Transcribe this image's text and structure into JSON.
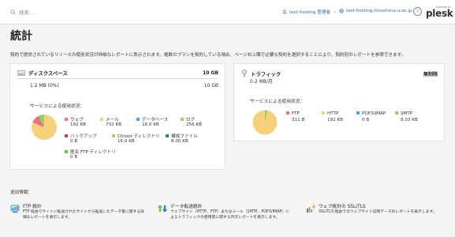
{
  "topbar": {
    "search_placeholder": "検索...",
    "user_label": "test-hosting 管理者",
    "domain_label": "test-hosting.hiroshima-u.ac.jp",
    "help_label": "?",
    "logo_small": "POWERED BY",
    "logo_text": "plesk"
  },
  "page": {
    "title": "統計",
    "description": "契約で提供されているリソースの使用状況が詳細なレポートに表示されます。複数のプランを契約している場合、ページ右上隅で必要な契約を選択することにより、契約別のレポートを参照できます。"
  },
  "disk": {
    "title": "ディスクスペース",
    "limit": "10 GB",
    "used": "1.2 MB (0%)",
    "total": "10 GB",
    "services_label": "サービスによる使用状況：",
    "items": [
      {
        "label": "ウェブ",
        "value": "192 KB",
        "color": "#e8737f"
      },
      {
        "label": "メール",
        "value": "732 KB",
        "color": "#f7d07a"
      },
      {
        "label": "データベース",
        "value": "16.0 KB",
        "color": "#4aa7e0"
      },
      {
        "label": "ログ",
        "value": "256 KB",
        "color": "#8bd36a"
      },
      {
        "label": "バックアップ",
        "value": "0 B",
        "color": "#b04848"
      },
      {
        "label": "Chroot ディレクトリ",
        "value": "16.0 KB",
        "color": "#d4b07a"
      },
      {
        "label": "構成ファイル",
        "value": "8.00 KB",
        "color": "#2f7bb5"
      },
      {
        "label": "匿名 FTP ディレクトリ",
        "value": "0 B",
        "color": "#6cc04a"
      }
    ]
  },
  "traffic": {
    "title": "トラフィック",
    "limit": "無制限",
    "used": "0.2 MB/月",
    "services_label": "サービスによる使用状況：",
    "items": [
      {
        "label": "FTP",
        "value": "311 B",
        "color": "#e8737f"
      },
      {
        "label": "HTTP",
        "value": "192 KB",
        "color": "#f7d07a"
      },
      {
        "label": "POP3/IMAP",
        "value": "0 B",
        "color": "#4aa7e0"
      },
      {
        "label": "SMTP",
        "value": "8.03 KB",
        "color": "#8bd36a"
      }
    ]
  },
  "additional": {
    "label": "追加情報：",
    "tools": [
      {
        "title": "FTP 統計",
        "desc": "FTP 経由でサイトに転送されたサイトから転送したデータ量に関する詳細なレポートを表示します。"
      },
      {
        "title": "データ転送統計",
        "desc": "ウェブサイト（HTTP、FTP）またはメール（SMTP、POP3/IMAP）によるトラフィックの使用量に関する月次レポートを表示します。"
      },
      {
        "title": "ウェブ統計の SSL/TLS",
        "desc": "SSL/TLS 経由でのウェブサイト訪問データのレポートを表示します。"
      }
    ]
  }
}
